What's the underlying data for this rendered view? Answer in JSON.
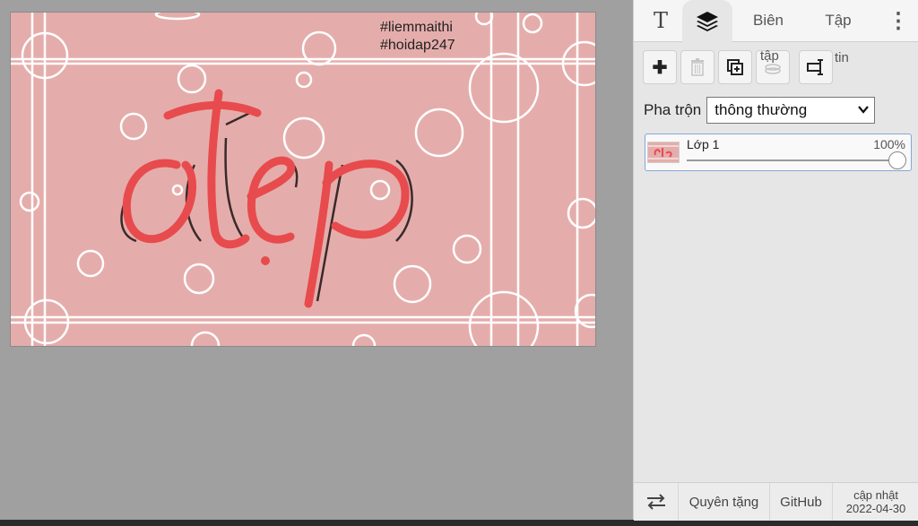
{
  "canvas": {
    "hashtag1": "#liemmaithi",
    "hashtag2": "#hoidap247",
    "word": "đẹp",
    "colors": {
      "background": "#e4adab",
      "lettering": "#e84b4d",
      "shadow": "#3a2a2a",
      "bubbles": "#ffffff"
    }
  },
  "panel": {
    "tabs": {
      "text_icon": "T",
      "layers_icon": "layers-icon",
      "bien": "Biên",
      "tap": "Tập",
      "more": "⋮"
    },
    "toolbar": {
      "add": "✚",
      "delete": "🗑",
      "duplicate": "⧉",
      "merge_label": "tập",
      "info_label": "tin"
    },
    "blend": {
      "label": "Pha trộn",
      "selected": "thông thường"
    },
    "layer": {
      "name": "Lớp 1",
      "opacity_label": "100%",
      "opacity": 1.0
    },
    "footer": {
      "donate": "Quyên tặng",
      "github": "GitHub",
      "update_label": "cập nhật",
      "update_date": "2022-04-30"
    }
  }
}
